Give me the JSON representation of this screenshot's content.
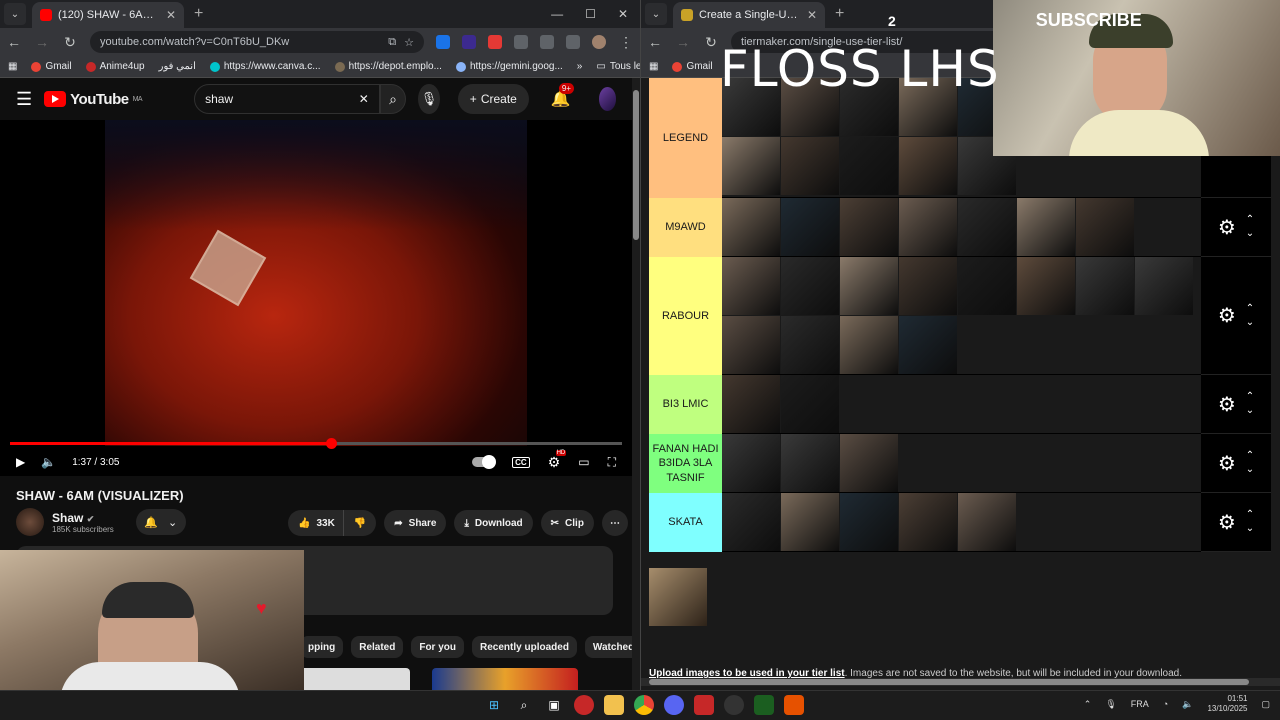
{
  "left_browser": {
    "tab_title": "(120) SHAW - 6AM (VISUALIZER)",
    "url": "youtube.com/watch?v=C0nT6bU_DKw",
    "bookmarks": [
      "Gmail",
      "Anime4up",
      "انمي فور",
      "https://www.canva.c...",
      "https://depot.emplo...",
      "https://gemini.goog..."
    ],
    "bookmarks_folder": "Tous les favoris",
    "bookmarks_more": "»"
  },
  "youtube": {
    "logo": "YouTube",
    "region": "MA",
    "search_value": "shaw",
    "create_label": "Create",
    "notif_count": "9+",
    "time": "1:37 / 3:05",
    "progress_fraction": 0.524,
    "video_title": "SHAW - 6AM (VISUALIZER)",
    "channel_name": "Shaw",
    "subscribers": "185K subscribers",
    "like_count": "33K",
    "share_label": "Share",
    "download_label": "Download",
    "clip_label": "Clip",
    "chips": [
      "pping",
      "Related",
      "For you",
      "Recently uploaded",
      "Watched"
    ]
  },
  "right_browser": {
    "tab_title": "Create a Single-Use Tier List (P...",
    "url": "tiermaker.com/single-use-tier-list/",
    "bookmark": "Gmail",
    "upload_link": "Upload images to be used in your tier list",
    "upload_rest": ". Images are not saved to the website, but will be included in your download."
  },
  "overlay": {
    "subscribe": "SUBSCRIBE",
    "number": "2",
    "big_text": "FLOSS LHS"
  },
  "tiers": [
    {
      "label": "LEGEND",
      "color": "#ffbf7f",
      "count": 13
    },
    {
      "label": "M9AWD",
      "color": "#ffdf7f",
      "count": 7
    },
    {
      "label": "RABOUR",
      "color": "#ffff7f",
      "count": 12
    },
    {
      "label": "BI3 LMIC",
      "color": "#bfff7f",
      "count": 2
    },
    {
      "label": "FANAN HADI B3IDA 3LA TASNIF",
      "color": "#7fff7f",
      "count": 3
    },
    {
      "label": "SKATA",
      "color": "#7fffff",
      "count": 5
    }
  ],
  "taskbar": {
    "lang": "FRA",
    "time": "01:51",
    "date": "13/10/2025"
  }
}
